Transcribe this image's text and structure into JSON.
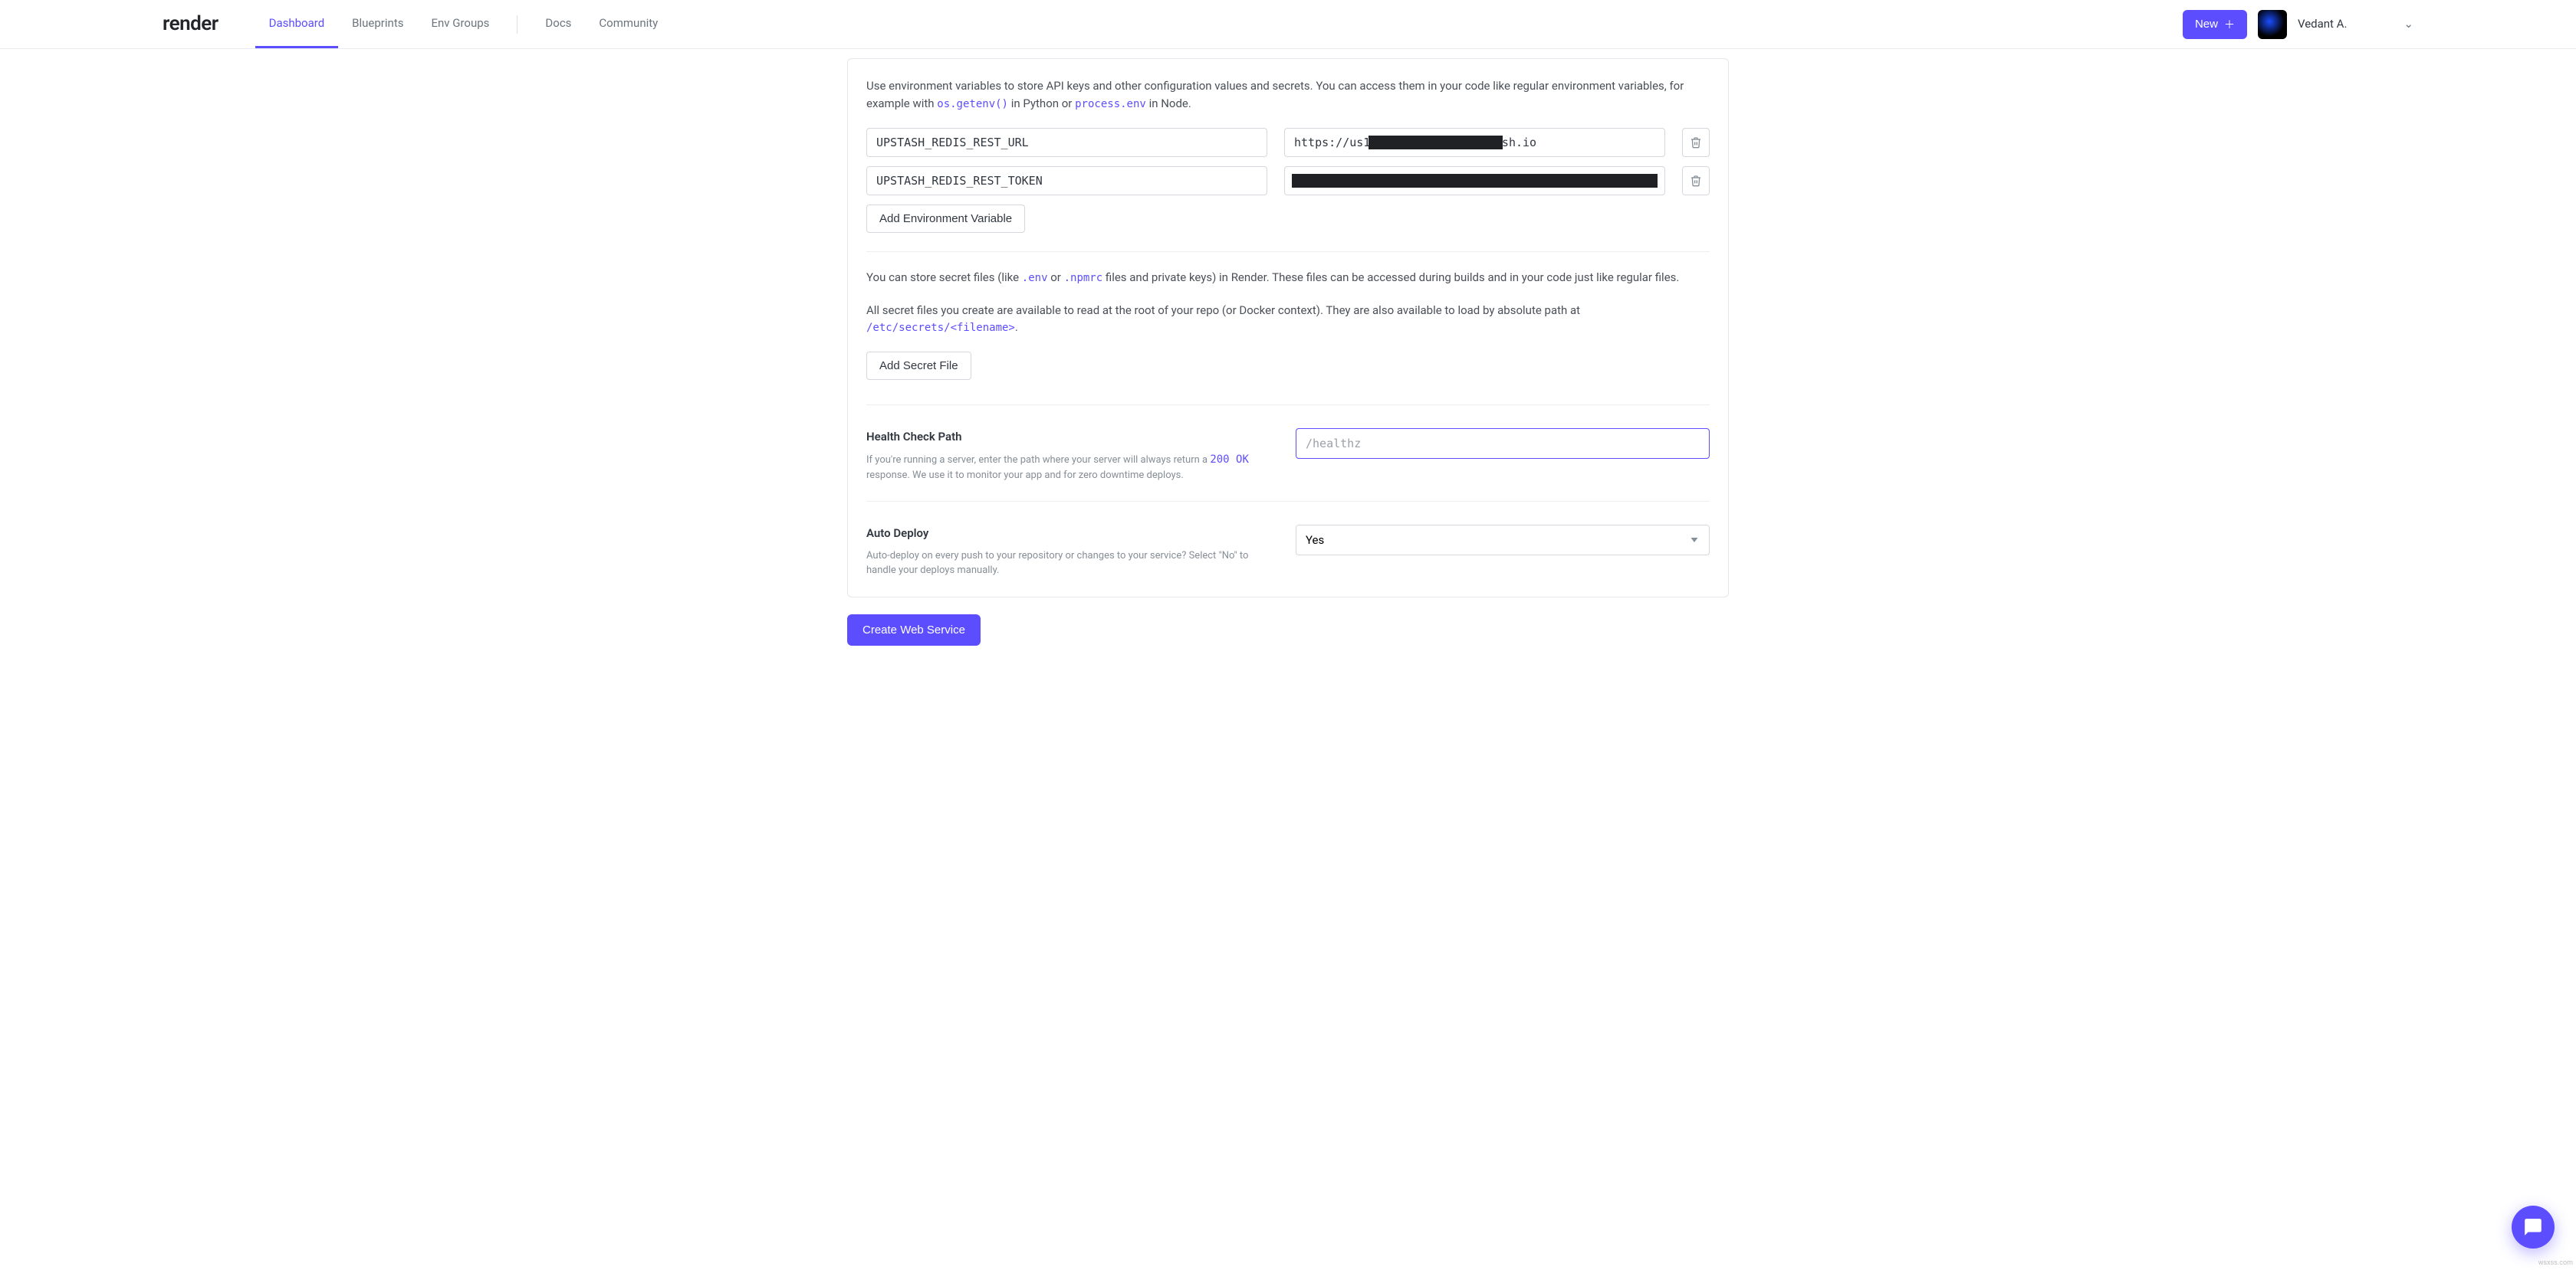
{
  "brand": "render",
  "nav": {
    "dashboard": "Dashboard",
    "blueprints": "Blueprints",
    "env_groups": "Env Groups",
    "docs": "Docs",
    "community": "Community"
  },
  "header": {
    "new_label": "New",
    "username": "Vedant A."
  },
  "env": {
    "intro_1": "Use environment variables to store API keys and other configuration values and secrets. You can access them in your code like regular environment variables, for example with ",
    "code_py": "os.getenv()",
    "intro_2": " in Python or ",
    "code_node": "process.env",
    "intro_3": " in Node.",
    "vars": [
      {
        "key": "UPSTASH_REDIS_REST_URL",
        "value": "https://us1-████████████.upstash.io",
        "redact": "partial"
      },
      {
        "key": "UPSTASH_REDIS_REST_TOKEN",
        "value": "",
        "redact": "full"
      }
    ],
    "add_env_label": "Add Environment Variable"
  },
  "secrets": {
    "para1_a": "You can store secret files (like ",
    "code_env": ".env",
    "para1_b": " or ",
    "code_npmrc": ".npmrc",
    "para1_c": " files and private keys) in Render. These files can be accessed during builds and in your code just like regular files.",
    "para2_a": "All secret files you create are available to read at the root of your repo (or Docker context). They are also available to load by absolute path at ",
    "code_path": "/etc/secrets/<filename>",
    "para2_b": ".",
    "add_secret_label": "Add Secret File"
  },
  "health": {
    "label": "Health Check Path",
    "help_a": "If you're running a server, enter the path where your server will always return a ",
    "code_ok": "200 OK",
    "help_b": " response. We use it to monitor your app and for zero downtime deploys.",
    "placeholder": "/healthz",
    "value": ""
  },
  "autodeploy": {
    "label": "Auto Deploy",
    "help": "Auto-deploy on every push to your repository or changes to your service? Select \"No\" to handle your deploys manually.",
    "value": "Yes"
  },
  "submit_label": "Create Web Service",
  "watermark": "wsxss.com"
}
